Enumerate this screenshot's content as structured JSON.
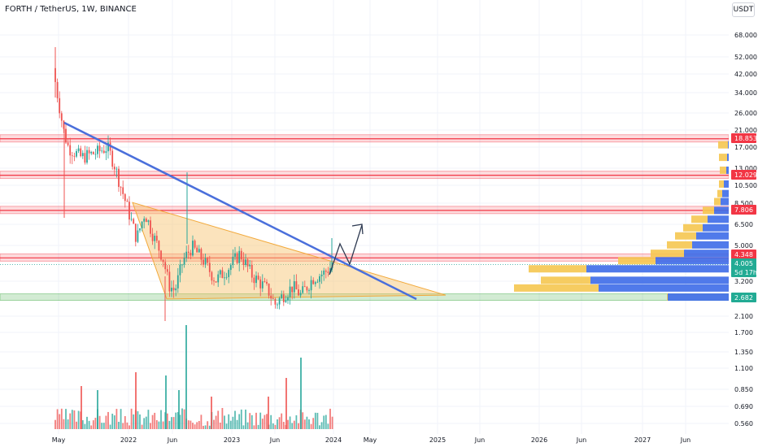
{
  "header": {
    "symbol": "FORTH / TetherUS, 1W, BINANCE",
    "currency": "USDT"
  },
  "chart_data": {
    "type": "candlestick",
    "price_scale": "log",
    "x_labels": [
      "May",
      "2022",
      "Jun",
      "2023",
      "Jun",
      "2024",
      "May",
      "2025",
      "Jun",
      "2026",
      "Jun",
      "2027",
      "Jun"
    ],
    "y_ticks": [
      "68.000",
      "52.000",
      "42.000",
      "34.000",
      "26.000",
      "21.000",
      "17.000",
      "13.000",
      "10.500",
      "8.500",
      "6.500",
      "5.000",
      "3.200",
      "2.100",
      "1.700",
      "1.350",
      "1.100",
      "0.850",
      "0.690",
      "0.560"
    ],
    "price_tags": [
      {
        "label": "18.853",
        "color": "#f23645"
      },
      {
        "label": "12.029",
        "color": "#f23645"
      },
      {
        "label": "7.806",
        "color": "#f23645"
      },
      {
        "label": "4.348",
        "color": "#f23645"
      },
      {
        "label": "4.005",
        "color": "#22ab94"
      },
      {
        "label": "5d 17h",
        "color": "#22ab94"
      },
      {
        "label": "2.682",
        "color": "#22ab94"
      }
    ],
    "resistance_zones": [
      18.853,
      12.029,
      7.806,
      4.348
    ],
    "support_zones": [
      2.682
    ],
    "colors": {
      "up": "#26a69a",
      "down": "#ef5350",
      "trendline": "#4a6fdb",
      "triangle_fill": "#f7c26b",
      "triangle_edge": "#f2a93b",
      "resistance": "#f23645",
      "support": "#4caf50",
      "vp_up": "#3d6ce8",
      "vp_down": "#f5c750"
    },
    "grid": true
  }
}
